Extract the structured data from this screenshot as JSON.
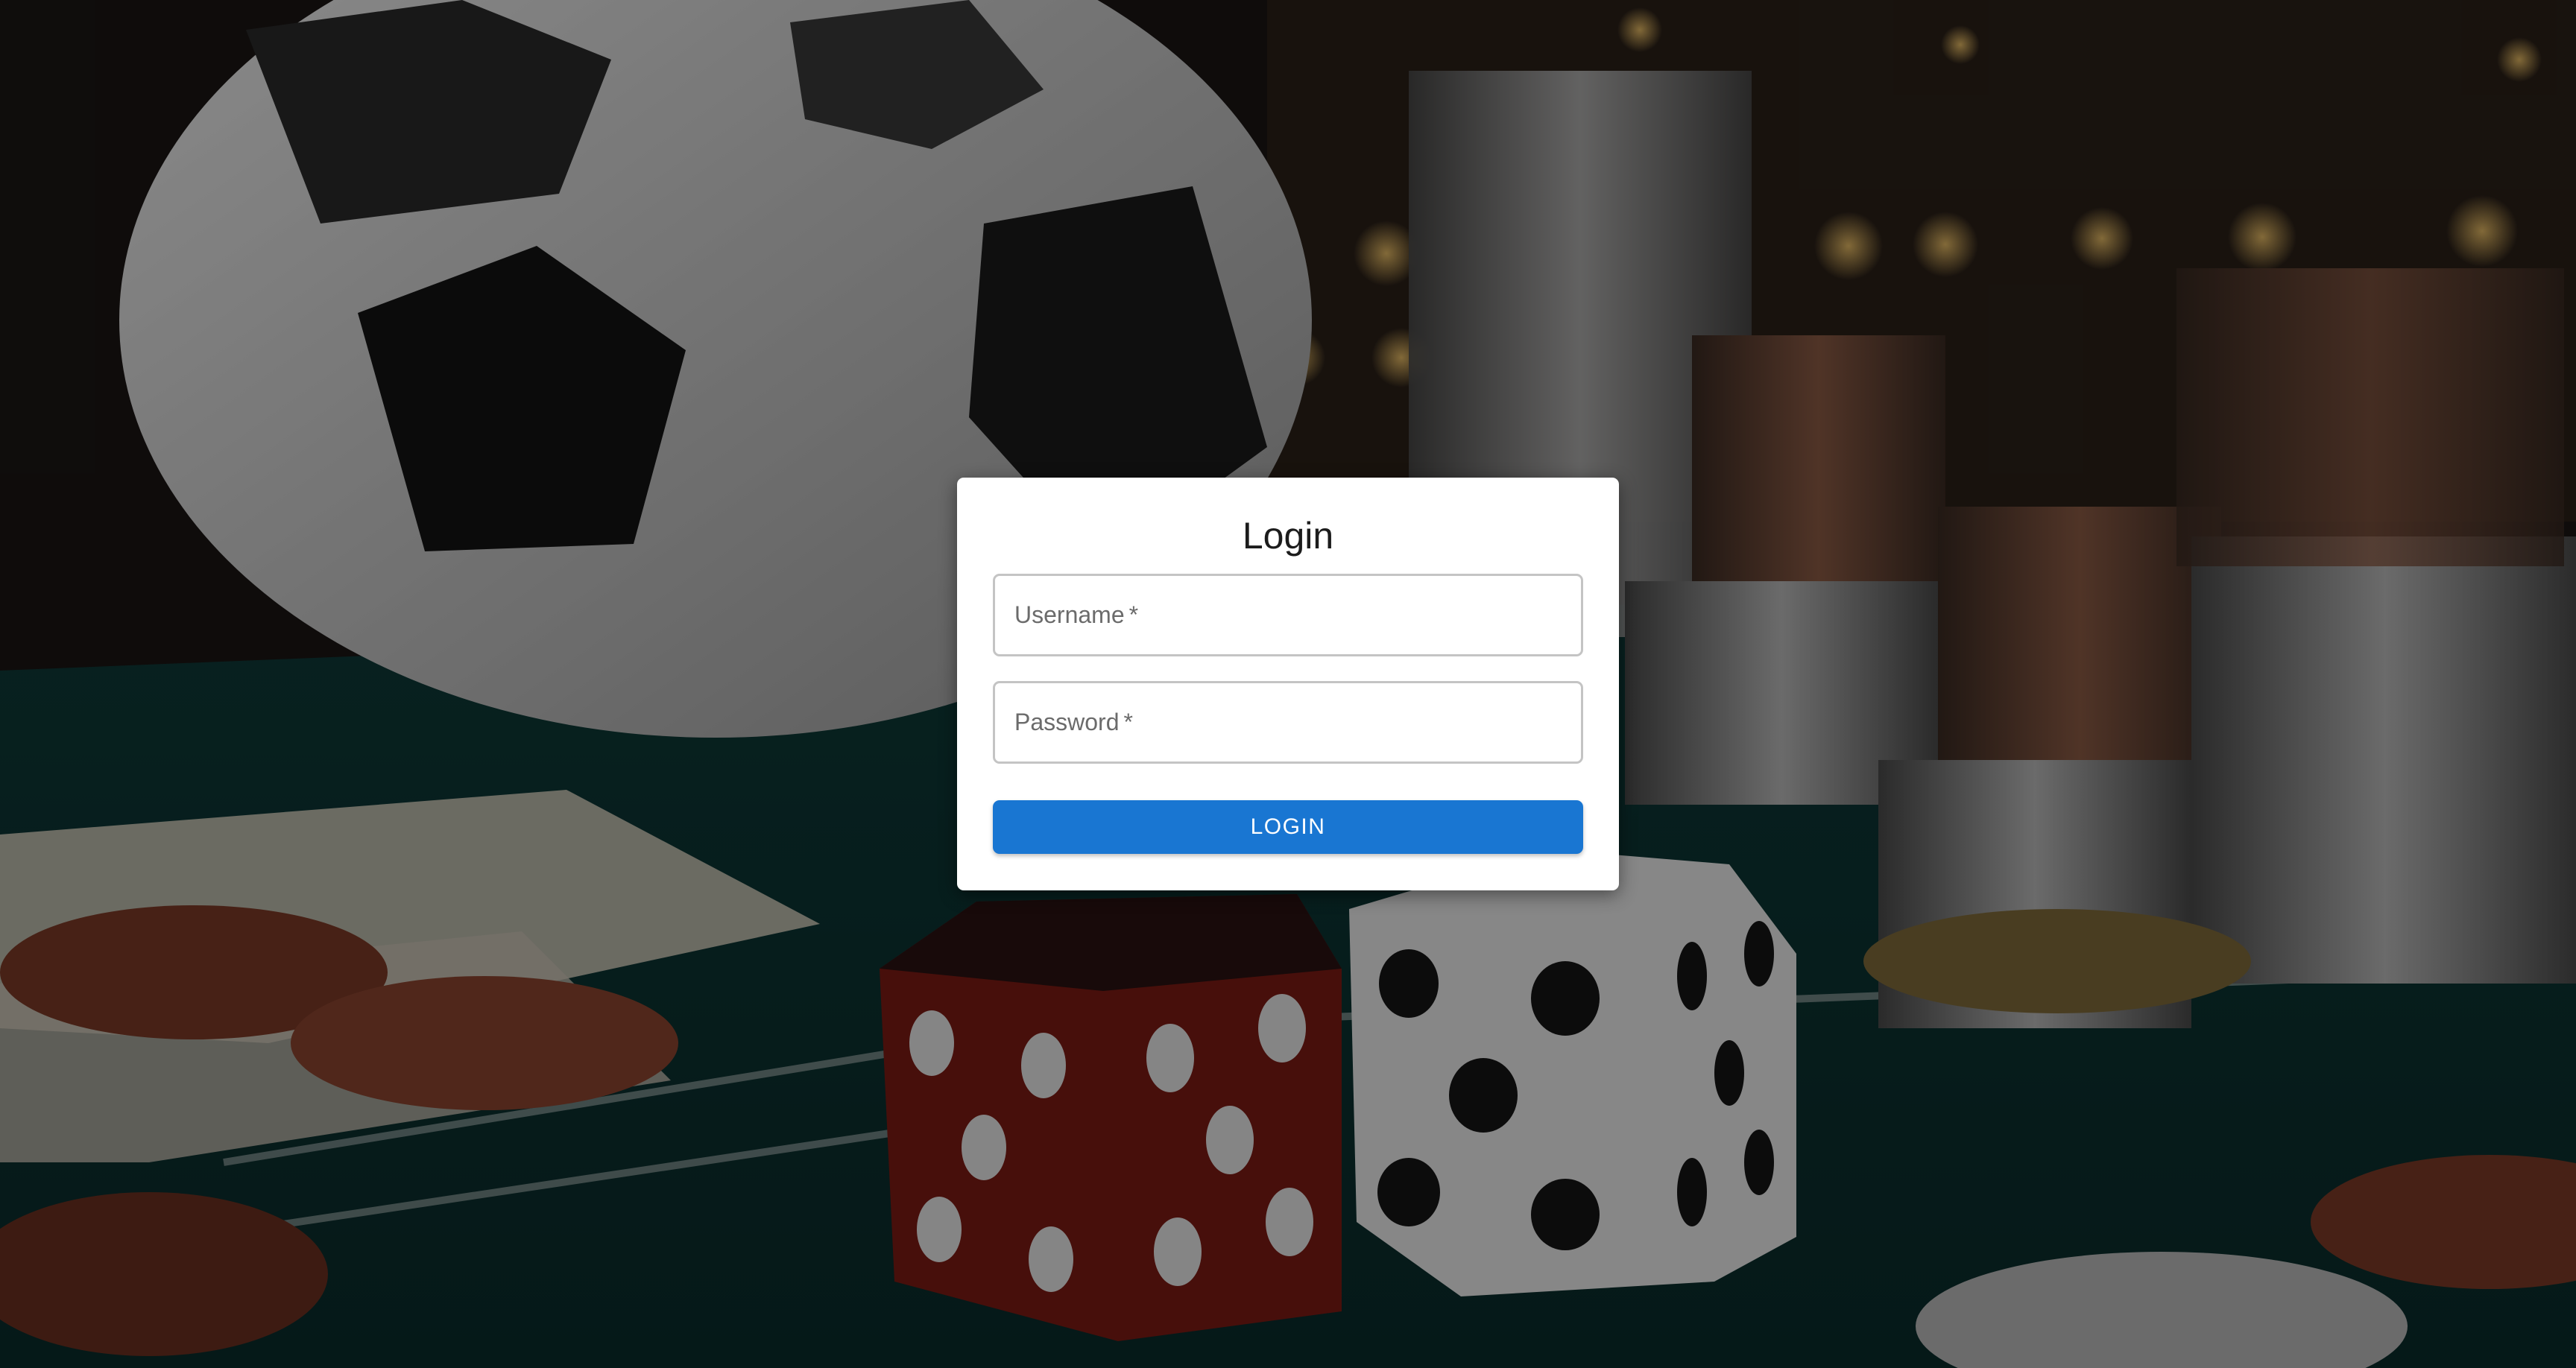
{
  "login_form": {
    "title": "Login",
    "username": {
      "label": "Username",
      "required_mark": "*",
      "value": ""
    },
    "password": {
      "label": "Password",
      "required_mark": "*",
      "value": ""
    },
    "submit_label": "LOGIN"
  },
  "theme": {
    "primary_button_color": "#1976d2",
    "card_background": "#ffffff",
    "field_border_color": "#c4c4c4"
  }
}
